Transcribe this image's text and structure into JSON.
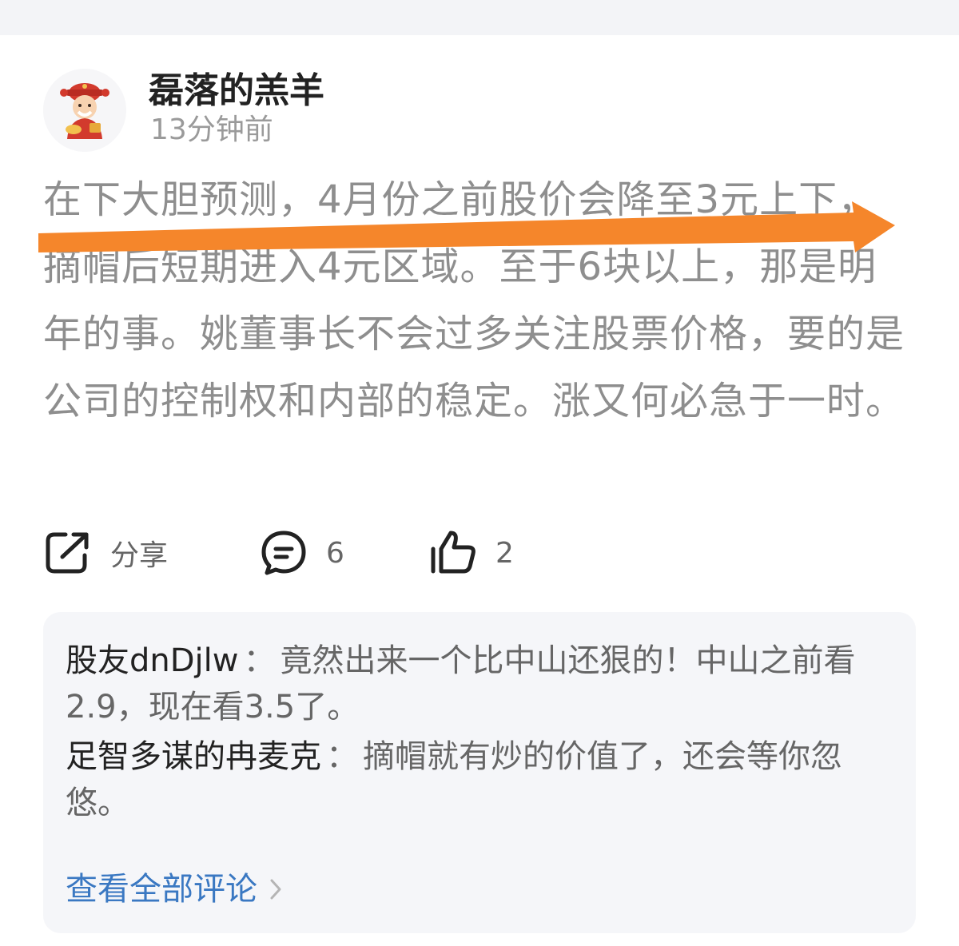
{
  "post": {
    "author": "磊落的羔羊",
    "time": "13分钟前",
    "content": "在下大胆预测，4月份之前股价会降至3元上下，摘帽后短期进入4元区域。至于6块以上，那是明年的事。姚董事长不会过多关注股票价格，要的是公司的控制权和内部的稳定。涨又何必急于一时。"
  },
  "actions": {
    "share_label": "分享",
    "comment_count": "6",
    "like_count": "2"
  },
  "comments": [
    {
      "user": "股友dnDjlw",
      "separator": "：",
      "text": "竟然出来一个比中山还狠的！中山之前看2.9，现在看3.5了。"
    },
    {
      "user": "足智多谋的冉麦克",
      "separator": "：",
      "text": "摘帽就有炒的价值了，还会等你忽悠。"
    }
  ],
  "view_all_label": "查看全部评论",
  "icons": {
    "avatar": "fortune-god-avatar-icon",
    "share": "share-icon",
    "comment": "comment-icon",
    "like": "thumbs-up-icon",
    "chevron": "chevron-right-icon",
    "annotation": "arrow-right-icon"
  },
  "colors": {
    "annotation_arrow": "#f5862b",
    "link": "#3a78c2",
    "body_text": "#8e8e8e"
  }
}
